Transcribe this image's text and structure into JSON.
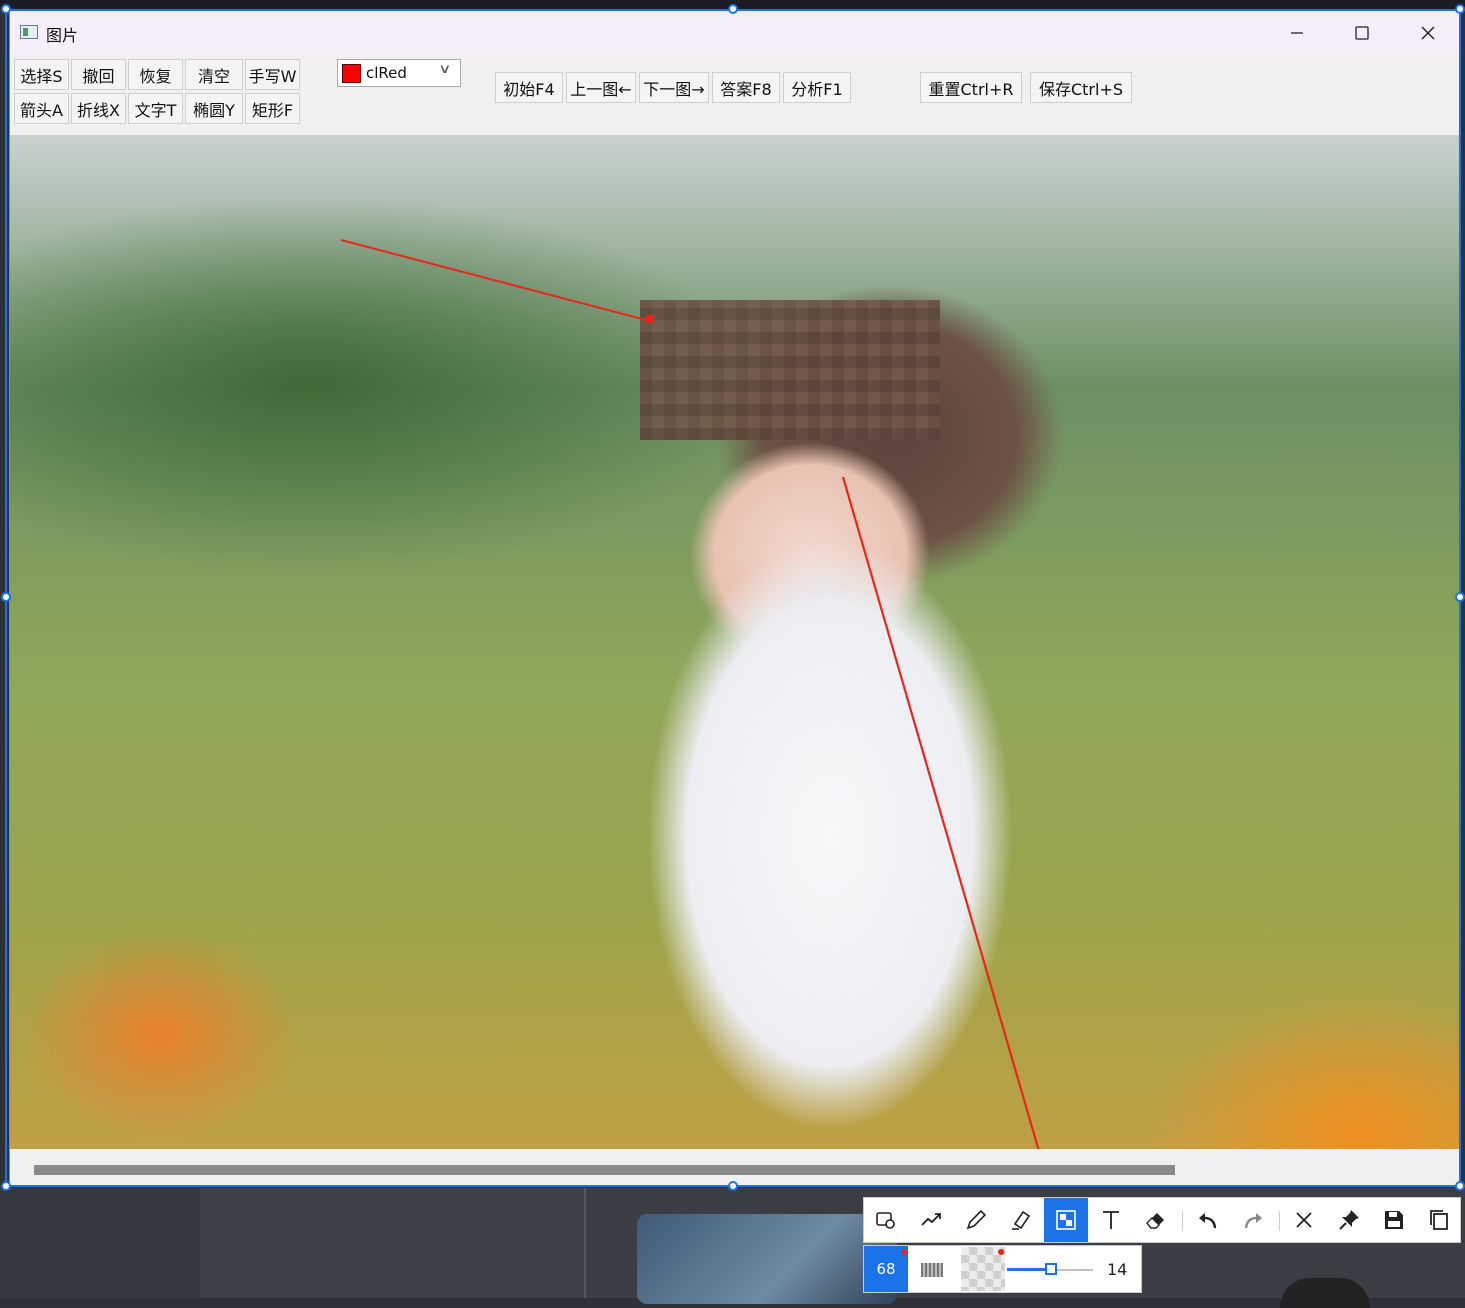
{
  "window": {
    "title": "图片"
  },
  "toolbar": {
    "row1": [
      "选择S",
      "撤回",
      "恢复",
      "清空",
      "手写W"
    ],
    "row2": [
      "箭头A",
      "折线X",
      "文字T",
      "椭圆Y",
      "矩形F"
    ],
    "color": {
      "value": "clRed",
      "swatch": "#ff0000"
    },
    "nav": [
      "初始F4",
      "上一图←",
      "下一图→",
      "答案F8",
      "分析F1"
    ],
    "actions": [
      "重置Ctrl+R",
      "保存Ctrl+S"
    ]
  },
  "snip_toolbar": {
    "tools": [
      "rectangle-icon",
      "polyline-icon",
      "pen-icon",
      "marker-icon",
      "mosaic-icon",
      "text-icon",
      "eraser-icon",
      "undo-icon",
      "redo-icon",
      "close-icon",
      "pin-icon",
      "save-icon",
      "copy-icon"
    ],
    "active_tool": "mosaic-icon",
    "accent": "#1a73e8",
    "size_value": "68",
    "slider_value": "14"
  },
  "annotations": {
    "stroke_color": "#e8261a"
  }
}
